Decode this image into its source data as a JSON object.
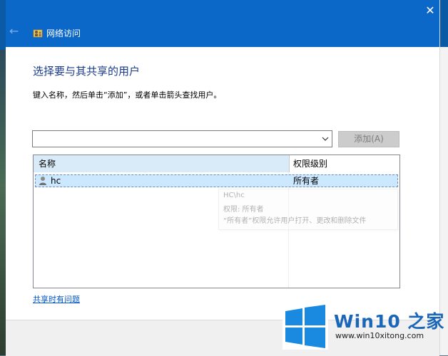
{
  "window": {
    "title": "网络访问",
    "close_glyph": "✕",
    "back_glyph": "←"
  },
  "content": {
    "heading": "选择要与其共享的用户",
    "instruction": "键入名称，然后单击“添加”，或者单击箭头查找用户。",
    "combo_value": "",
    "add_button": "添加(A)"
  },
  "table": {
    "columns": [
      "名称",
      "权限级别"
    ],
    "rows": [
      {
        "name": "hc",
        "permission": "所有者"
      }
    ]
  },
  "tooltip": {
    "lines": [
      "HC\\hc",
      "权限: 所有者",
      "“所有者”权限允许用户打开、更改和删除文件"
    ]
  },
  "help_link": "共享时有问题",
  "watermark": {
    "brand": "Win10 之家",
    "url": "www.win10xitong.com"
  },
  "colors": {
    "titlebar": "#0b67c8",
    "heading": "#1a3a8c",
    "link": "#0055cc",
    "selection": "#cce8ff"
  },
  "icons": [
    "back-arrow-icon",
    "network-sharing-icon",
    "close-icon",
    "dropdown-arrow-icon",
    "user-icon",
    "windows-logo-icon"
  ]
}
